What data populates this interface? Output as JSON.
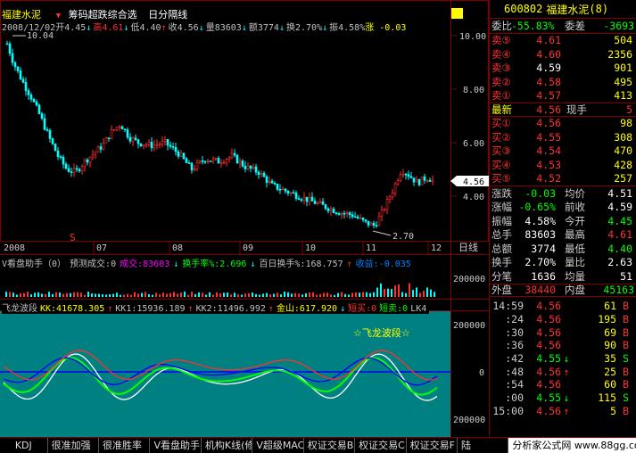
{
  "header": {
    "stock_name": "福建水泥",
    "marker": "▼",
    "menu_label": "筹码超跌综合选",
    "period_label": "日分隔线",
    "info_items": [
      {
        "text": "2008/12/02",
        "color": "#c0c0c0"
      },
      {
        "text": "开4.45",
        "color": "#c0c0c0"
      },
      {
        "text": "↓",
        "color": "#00ffff"
      },
      {
        "text": "高4.61",
        "color": "#ff3030"
      },
      {
        "text": "↓",
        "color": "#00ffff"
      },
      {
        "text": "低4.40",
        "color": "#c0c0c0"
      },
      {
        "text": "↑",
        "color": "#ff3030"
      },
      {
        "text": "收4.56",
        "color": "#c0c0c0"
      },
      {
        "text": "↓",
        "color": "#00ffff"
      },
      {
        "text": "量83603",
        "color": "#c0c0c0"
      },
      {
        "text": "↓",
        "color": "#00ffff"
      },
      {
        "text": "额3774",
        "color": "#c0c0c0"
      },
      {
        "text": "↓",
        "color": "#00ffff"
      },
      {
        "text": "换2.70%",
        "color": "#c0c0c0"
      },
      {
        "text": "↓",
        "color": "#00ffff"
      },
      {
        "text": "振4.58%",
        "color": "#c0c0c0"
      },
      {
        "text": "涨 -0.03",
        "color": "#ffff00"
      }
    ]
  },
  "price_axis": {
    "ticks": [
      "10.00",
      "8.00",
      "6.00",
      "4.00"
    ],
    "current_label": "4.56",
    "high_label": "10.04",
    "low_label": "2.70",
    "event_marker": "S"
  },
  "date_axis": {
    "labels": [
      "2008",
      "07",
      "08",
      "09",
      "10",
      "11",
      "12"
    ],
    "period_button": "日线"
  },
  "indicator1": {
    "items": [
      {
        "text": "V看盘助手（0）",
        "color": "#c0c0c0"
      },
      {
        "text": "预测成交:0",
        "color": "#c0c0c0"
      },
      {
        "text": "成交:83603",
        "color": "#ff00ff"
      },
      {
        "text": "↓",
        "color": "#00ffff"
      },
      {
        "text": "换手率%:2.696",
        "color": "#00ff00"
      },
      {
        "text": "↓",
        "color": "#00ffff"
      },
      {
        "text": "百日换手%:168.757",
        "color": "#c0c0c0"
      },
      {
        "text": "↑",
        "color": "#ff3030"
      },
      {
        "text": "收益:-0.035",
        "color": "#0080ff"
      }
    ],
    "axis_label": "200000"
  },
  "indicator2": {
    "items": [
      {
        "text": "飞龙波段",
        "color": "#c0c0c0"
      },
      {
        "text": "KK:41678.305",
        "color": "#ffff00"
      },
      {
        "text": "↑",
        "color": "#ff3030"
      },
      {
        "text": "KK1:15936.189",
        "color": "#c0c0c0"
      },
      {
        "text": "↑",
        "color": "#ff3030"
      },
      {
        "text": "KK2:11496.992",
        "color": "#c0c0c0"
      },
      {
        "text": "↑",
        "color": "#ff3030"
      },
      {
        "text": "金山:617.920",
        "color": "#ffff00"
      },
      {
        "text": "↓",
        "color": "#00ffff"
      },
      {
        "text": "短买:0",
        "color": "#ff3030"
      },
      {
        "text": "短卖:0",
        "color": "#00ff00"
      },
      {
        "text": "LK4",
        "color": "#c0c0c0"
      }
    ],
    "axis_labels": [
      "200000",
      "0",
      "200000"
    ],
    "annotation": "☆飞龙波段☆"
  },
  "quote_panel": {
    "code": "600802",
    "name": "福建水泥",
    "count": "(8)",
    "ratio_label": "委比",
    "ratio_value": "-55.83%",
    "diff_label": "委差",
    "diff_value": "-3693",
    "sells": [
      {
        "label": "卖⑤",
        "price": "4.61",
        "vol": "504",
        "color": "#ff3030"
      },
      {
        "label": "卖④",
        "price": "4.60",
        "vol": "2356",
        "color": "#ff3030"
      },
      {
        "label": "卖③",
        "price": "4.59",
        "vol": "901",
        "color": "#ffffff"
      },
      {
        "label": "卖②",
        "price": "4.58",
        "vol": "495",
        "color": "#ff3030"
      },
      {
        "label": "卖①",
        "price": "4.57",
        "vol": "413",
        "color": "#ff3030"
      }
    ],
    "latest_label": "最新",
    "latest_value": "4.56",
    "hand_label": "现手",
    "hand_value": "5",
    "buys": [
      {
        "label": "买①",
        "price": "4.56",
        "vol": "98",
        "color": "#ff3030"
      },
      {
        "label": "买②",
        "price": "4.55",
        "vol": "308",
        "color": "#ff3030"
      },
      {
        "label": "买③",
        "price": "4.54",
        "vol": "470",
        "color": "#ff3030"
      },
      {
        "label": "买④",
        "price": "4.53",
        "vol": "428",
        "color": "#ff3030"
      },
      {
        "label": "买⑤",
        "price": "4.52",
        "vol": "257",
        "color": "#ff3030"
      }
    ],
    "stats": [
      {
        "l1": "涨跌",
        "v1": "-0.03",
        "c1": "#00ff00",
        "l2": "均价",
        "v2": "4.51",
        "c2": "#ffffff"
      },
      {
        "l1": "涨幅",
        "v1": "-0.65%",
        "c1": "#00ff00",
        "l2": "前收",
        "v2": "4.59",
        "c2": "#ffffff"
      },
      {
        "l1": "振幅",
        "v1": "4.58%",
        "c1": "#ffffff",
        "l2": "今开",
        "v2": "4.45",
        "c2": "#00ff00"
      },
      {
        "l1": "总手",
        "v1": "83603",
        "c1": "#ffffff",
        "l2": "最高",
        "v2": "4.61",
        "c2": "#ff3030"
      },
      {
        "l1": "总额",
        "v1": "3774",
        "c1": "#ffffff",
        "l2": "最低",
        "v2": "4.40",
        "c2": "#00ff00"
      },
      {
        "l1": "换手",
        "v1": "2.70%",
        "c1": "#ffffff",
        "l2": "量比",
        "v2": "2.63",
        "c2": "#ffffff"
      },
      {
        "l1": "分笔",
        "v1": "1636",
        "c1": "#ffffff",
        "l2": "均量",
        "v2": "51",
        "c2": "#ffffff"
      }
    ],
    "outer_label": "外盘",
    "outer_value": "38440",
    "inner_label": "内盘",
    "inner_value": "45163",
    "ticks": [
      {
        "time": "14:59",
        "price": "4.56",
        "arrow": "",
        "vol": "61",
        "side": "B",
        "vcolor": "#ff3030"
      },
      {
        "time": ":24",
        "price": "4.56",
        "arrow": "",
        "vol": "195",
        "side": "B",
        "vcolor": "#ff3030"
      },
      {
        "time": ":30",
        "price": "4.56",
        "arrow": "",
        "vol": "69",
        "side": "B",
        "vcolor": "#ff3030"
      },
      {
        "time": ":36",
        "price": "4.56",
        "arrow": "",
        "vol": "90",
        "side": "B",
        "vcolor": "#ff3030"
      },
      {
        "time": ":42",
        "price": "4.55",
        "arrow": "↓",
        "vol": "35",
        "side": "S",
        "vcolor": "#00ff00"
      },
      {
        "time": ":48",
        "price": "4.56",
        "arrow": "↑",
        "vol": "25",
        "side": "B",
        "vcolor": "#ff3030"
      },
      {
        "time": ":54",
        "price": "4.56",
        "arrow": "",
        "vol": "60",
        "side": "B",
        "vcolor": "#ff3030"
      },
      {
        "time": ":00",
        "price": "4.55",
        "arrow": "↓",
        "vol": "115",
        "side": "S",
        "vcolor": "#00ff00"
      },
      {
        "time": "15:00",
        "price": "4.56",
        "arrow": "↑",
        "vol": "5",
        "side": "B",
        "vcolor": "#ff3030"
      }
    ]
  },
  "tabs": [
    "KDJ",
    "很准加强",
    "很准胜率",
    "V看盘助手",
    "机构K线(修",
    "V超级MACD",
    "权证交易B",
    "权证交易C",
    "权证交易F",
    "陆"
  ],
  "logo": "分析家公式网 www.88gg.com",
  "colors": {
    "up": "#ff3030",
    "down": "#00ffff",
    "frame": "#800000",
    "teal": "#008080"
  }
}
